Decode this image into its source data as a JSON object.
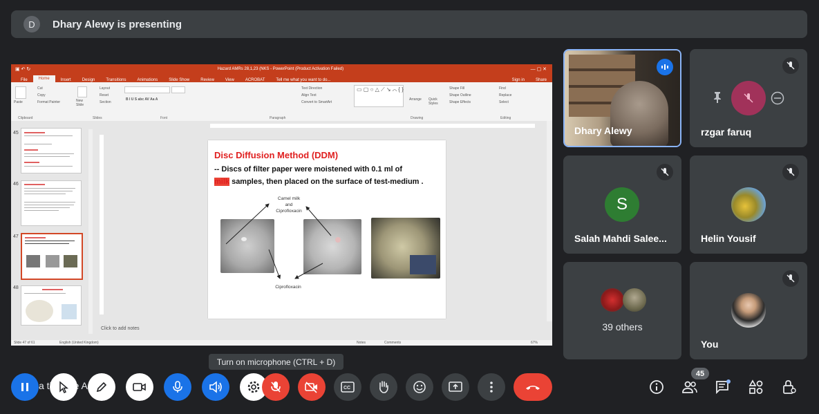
{
  "banner": {
    "avatar_letter": "D",
    "text": "Dhary Alewy is presenting"
  },
  "presentation": {
    "window_title": "Hazard AMRs 28,1,23 (NKS - PowerPoint (Product Activation Failed)",
    "tabs": [
      "File",
      "Home",
      "Insert",
      "Design",
      "Transitions",
      "Animations",
      "Slide Show",
      "Review",
      "View",
      "ACROBAT",
      "Tell me what you want to do..."
    ],
    "right_tabs": [
      "Sign in",
      "Share"
    ],
    "ribbon_groups": [
      "Clipboard",
      "Slides",
      "Font",
      "Paragraph",
      "Drawing",
      "Editing"
    ],
    "ribbon_items": {
      "paste": "Paste",
      "cut": "Cut",
      "copy": "Copy",
      "format_painter": "Format Painter",
      "new_slide": "New Slide",
      "layout": "Layout",
      "reset": "Reset",
      "section": "Section",
      "text_direction": "Text Direction",
      "align_text": "Align Text",
      "convert": "Convert to SmartArt",
      "arrange": "Arrange",
      "quick_styles": "Quick Styles",
      "shape_fill": "Shape Fill",
      "shape_outline": "Shape Outline",
      "shape_effects": "Shape Effects",
      "find": "Find",
      "replace": "Replace",
      "select": "Select"
    },
    "thumb_numbers": [
      "45",
      "46",
      "47",
      "48"
    ],
    "slide": {
      "title": "Disc Diffusion Method (DDM)",
      "line1": "-- Discs of filter paper  were moistened with 0.1 ml of",
      "line2_red": "milk",
      "line2_rest": " samples, then placed on the surface of test-medium .",
      "label_top_1": "Camel milk",
      "label_top_2": "and",
      "label_top_3": "Ciprofloxacin",
      "label_bottom": "Ciprofloxacin"
    },
    "notes_placeholder": "Click to add notes",
    "status": {
      "slide": "Slide 47 of 61",
      "language": "English (United Kingdom)",
      "notes": "Notes",
      "comments": "Comments",
      "zoom": "67%"
    }
  },
  "participants": [
    {
      "name": "Dhary Alewy"
    },
    {
      "name": "rzgar faruq"
    },
    {
      "name": "Salah Mahdi Salee...",
      "avatar_letter": "S",
      "avatar_color": "#2e7d32"
    },
    {
      "name": "Helin Yousif"
    },
    {
      "name": "39 others"
    },
    {
      "name": "You"
    }
  ],
  "tooltip": "Turn on microphone (CTRL + D)",
  "caption_text": "a  th  ro  se  Ar  r.",
  "people_count": "45",
  "colors": {
    "end_call": "#ea4335",
    "accent": "#1a73e8",
    "tile": "#3c4043",
    "ppt": "#c43e1c"
  }
}
